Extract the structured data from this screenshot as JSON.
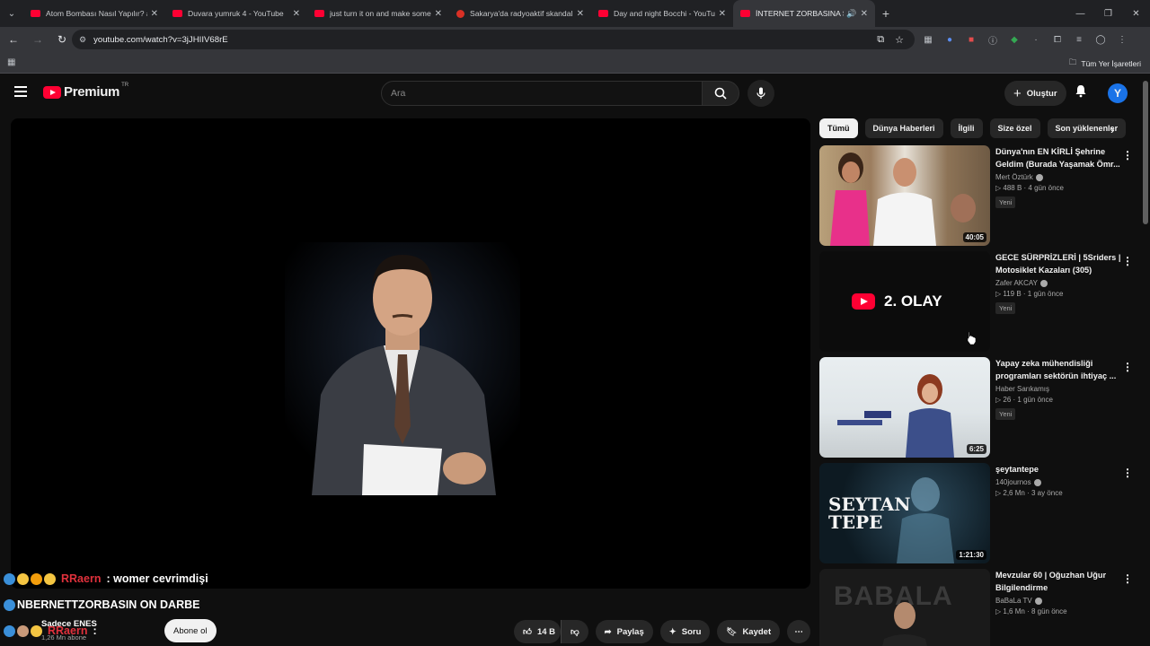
{
  "browser": {
    "tabs": [
      {
        "title": "Atom Bombası Nasıl Yapılır? #s"
      },
      {
        "title": "Duvara yumruk 4 - YouTube"
      },
      {
        "title": "just turn it on and make someth"
      },
      {
        "title": "Sakarya'da radyoaktif skandalı"
      },
      {
        "title": "Day and night Bocchi - YouTub"
      },
      {
        "title": "İNTERNET ZORBASINA SON"
      }
    ],
    "url": "youtube.com/watch?v=3jJHIIV68rE",
    "bookmarks_all": "Tüm Yer İşaretleri"
  },
  "youtube": {
    "logo": "Premium",
    "region": "TR",
    "search_placeholder": "Ara",
    "create_label": "Oluştur",
    "avatar_letter": "Y"
  },
  "overlay": {
    "chat": [
      {
        "user": "RRaern",
        "msg": ": womer cevrimdişi"
      },
      {
        "user": "",
        "msg": "NBERNETTZORBASIN ON DARBE"
      },
      {
        "user": "RRaern",
        "msg": ": "
      }
    ],
    "channel_name": "Sadece ENES",
    "channel_subs": "1,26 Mn abone",
    "subscribe_label": "Abone ol"
  },
  "actions": {
    "likes": "14 B",
    "share": "Paylaş",
    "ask": "Soru",
    "save": "Kaydet"
  },
  "chips": [
    "Tümü",
    "Dünya Haberleri",
    "İlgili",
    "Size özel",
    "Son yüklenenler"
  ],
  "recommendations": [
    {
      "title": "Dünya'nın EN KİRLİ Şehrine Geldim (Burada Yaşamak Ömr...",
      "channel": "Mert Öztürk",
      "views": "488 B",
      "age": "4 gün önce",
      "badge": "Yeni",
      "duration": "40:05"
    },
    {
      "title": "GECE SÜRPRİZLERİ | 5Sriders | Motosiklet Kazaları (305)",
      "channel": "Zafer AKCAY",
      "views": "119 B",
      "age": "1 gün önce",
      "badge": "Yeni",
      "duration": "",
      "thumb_text": "2. OLAY"
    },
    {
      "title": "Yapay zeka mühendisliği programları sektörün ihtiyaç ...",
      "channel": "Haber Sarıkamış",
      "views": "26",
      "age": "1 gün önce",
      "badge": "Yeni",
      "duration": "6:25"
    },
    {
      "title": "şeytantepe",
      "channel": "140journos",
      "views": "2,6 Mn",
      "age": "3 ay önce",
      "badge": "",
      "duration": "1:21:30",
      "thumb_text": "SEYTAN TEPE"
    },
    {
      "title": "Mevzular 60 | Oğuzhan Uğur Bilgilendirme",
      "channel": "BaBaLa TV",
      "views": "1,6 Mn",
      "age": "8 gün önce",
      "badge": "",
      "duration": "",
      "thumb_text": "BABALA"
    }
  ]
}
